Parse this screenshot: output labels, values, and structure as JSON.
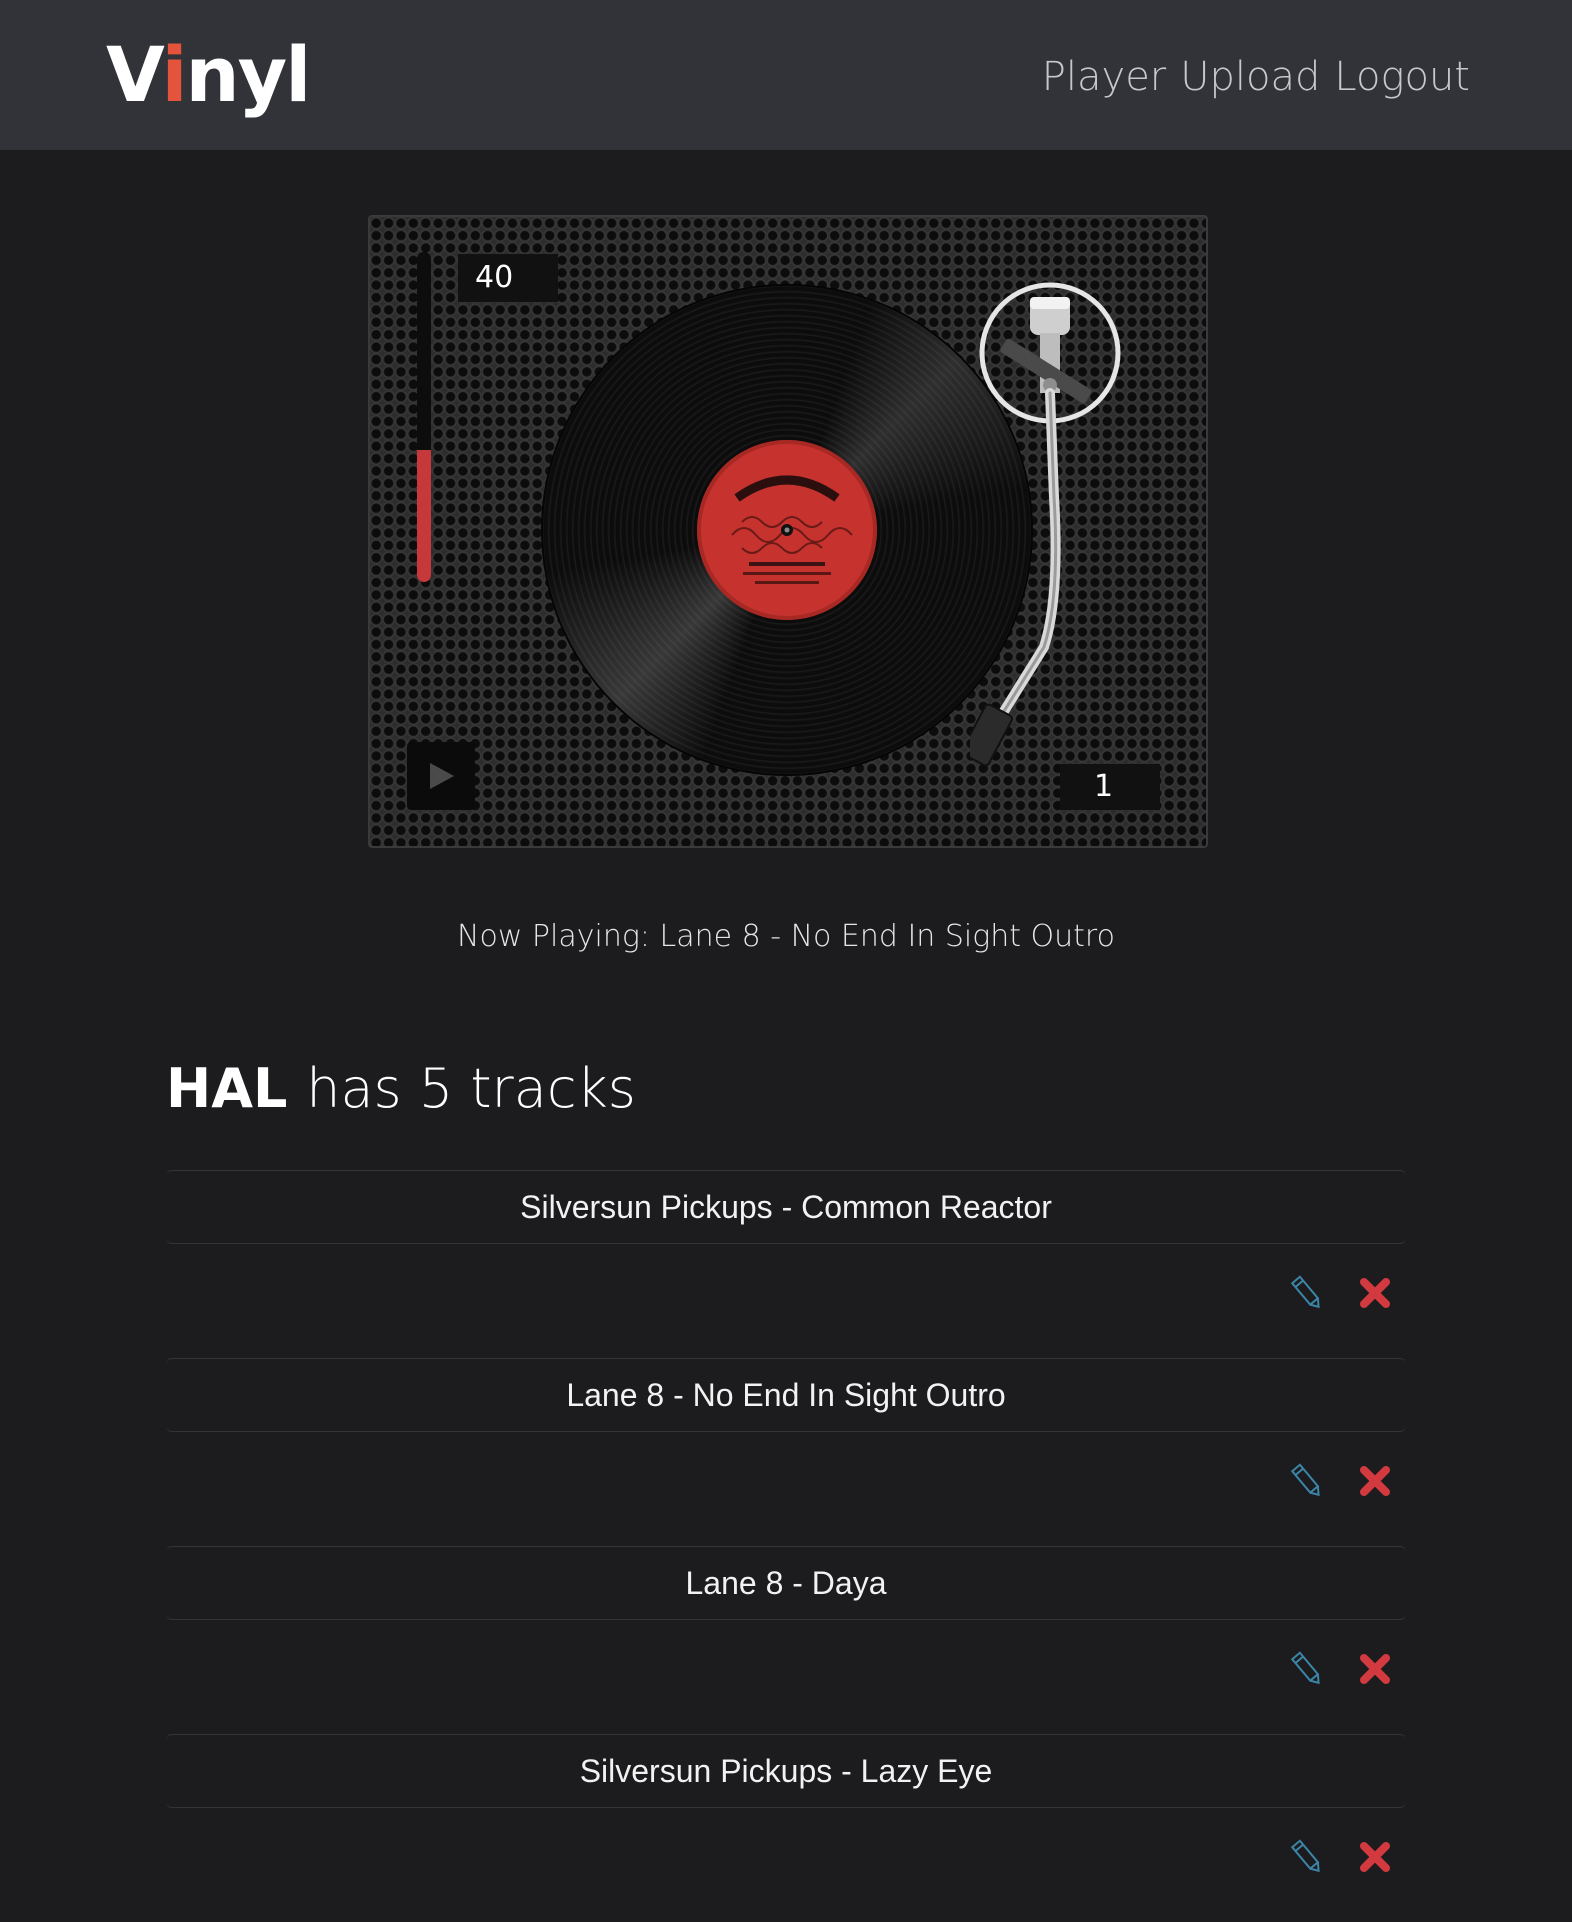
{
  "nav": {
    "brand_prefix": "V",
    "brand_accent": "i",
    "brand_suffix": "nyl",
    "links": [
      "Player",
      "Upload",
      "Logout"
    ]
  },
  "player": {
    "volume": 40,
    "volume_level": 0.4,
    "speed": 1,
    "play_icon": "play-icon",
    "record_label_color": "#c6332f"
  },
  "now_playing": "Now Playing: Lane 8 - No End In Sight Outro",
  "library": {
    "user": "HAL",
    "summary": "has 5 tracks",
    "tracks": [
      "Silversun Pickups - Common Reactor",
      "Lane 8 - No End In Sight Outro",
      "Lane 8 - Daya",
      "Silversun Pickups - Lazy Eye"
    ],
    "edit_icon": "pencil-icon",
    "delete_icon": "close-icon"
  },
  "colors": {
    "accent": "#e4533b",
    "delete": "#d23a3f",
    "edit": "#3a86a8",
    "navbar": "#313338",
    "background": "#1c1c1e"
  }
}
